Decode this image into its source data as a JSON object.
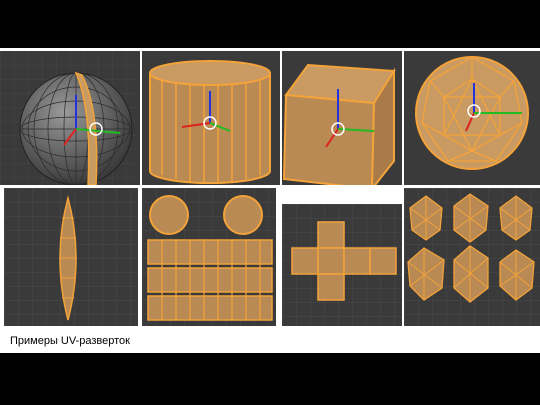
{
  "caption": "Примеры UV-разверток",
  "colors": {
    "background": "#000000",
    "slide": "#ffffff",
    "viewport": "#3a3a3a",
    "grid": "#4a4a4a",
    "mesh_fill": "#b98a54",
    "edge_highlight": "#f3a33a",
    "axis_z": "#2233dd",
    "axis_x": "#dd2222",
    "axis_y": "#22bb22"
  },
  "views_3d": [
    {
      "object": "uv-sphere",
      "mode": "edit"
    },
    {
      "object": "cylinder",
      "mode": "edit"
    },
    {
      "object": "cube",
      "mode": "edit"
    },
    {
      "object": "icosphere",
      "mode": "edit"
    }
  ],
  "uv_editors": [
    {
      "object": "uv-sphere"
    },
    {
      "object": "cylinder"
    },
    {
      "object": "cube"
    },
    {
      "object": "icosphere"
    }
  ]
}
